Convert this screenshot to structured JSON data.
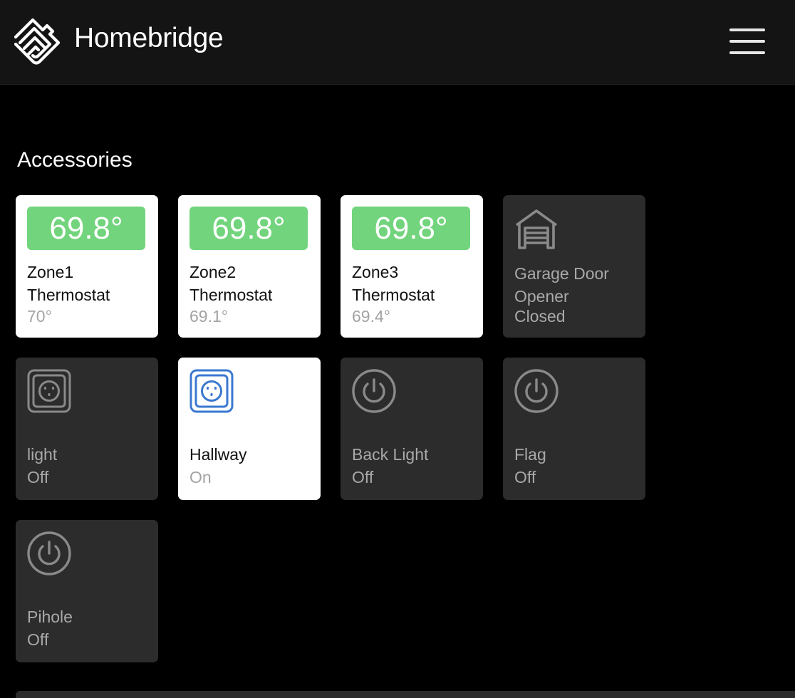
{
  "header": {
    "brand_name": "Homebridge",
    "logo_icon": "homebridge-logo-icon",
    "menu_icon": "hamburger-menu-icon"
  },
  "accessories": {
    "title": "Accessories",
    "tiles": [
      {
        "line1": "Zone1",
        "line2": "Thermostat",
        "status": "70°",
        "current_temp": "69.8°",
        "state": "on",
        "icon": "temperature-badge"
      },
      {
        "line1": "Zone2",
        "line2": "Thermostat",
        "status": "69.1°",
        "current_temp": "69.8°",
        "state": "on",
        "icon": "temperature-badge"
      },
      {
        "line1": "Zone3",
        "line2": "Thermostat",
        "status": "69.4°",
        "current_temp": "69.8°",
        "state": "on",
        "icon": "temperature-badge"
      },
      {
        "line1": "Garage Door",
        "line2": "Opener",
        "status": "Closed",
        "state": "off",
        "icon": "garage-icon"
      },
      {
        "line1": "light",
        "status": "Off",
        "state": "off",
        "icon": "outlet-icon"
      },
      {
        "line1": "Hallway",
        "status": "On",
        "state": "on",
        "icon": "outlet-icon"
      },
      {
        "line1": "Back Light",
        "status": "Off",
        "state": "off",
        "icon": "power-icon"
      },
      {
        "line1": "Flag",
        "status": "Off",
        "state": "off",
        "icon": "power-icon"
      },
      {
        "line1": "Pihole",
        "status": "Off",
        "state": "off",
        "icon": "power-icon"
      }
    ]
  },
  "colors": {
    "background": "#000000",
    "header": "#141414",
    "tile_on": "#ffffff",
    "tile_off": "#2c2c2c",
    "thermostat_green": "#72d47c",
    "outlet_active_blue": "#3a78d0"
  }
}
